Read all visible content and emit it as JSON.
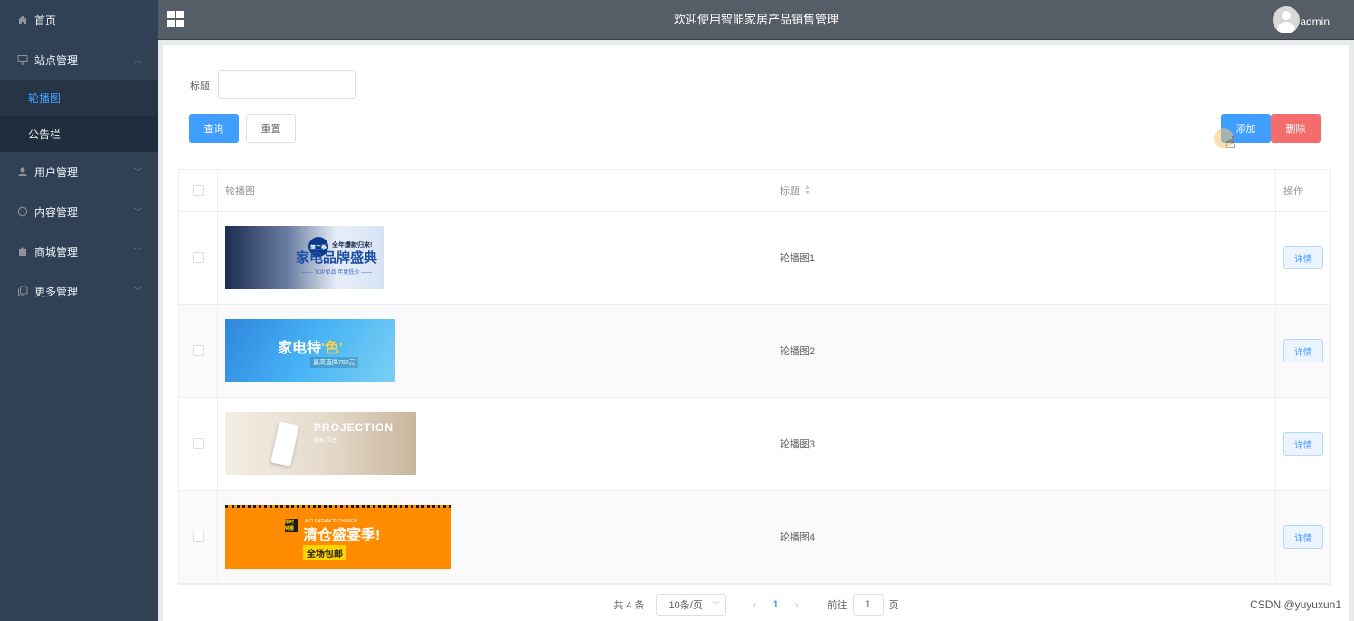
{
  "app": {
    "title": "欢迎使用智能家居产品销售管理",
    "username": "admin",
    "watermark": "CSDN @yuyuxun1"
  },
  "sidebar": {
    "items": [
      {
        "label": "首页",
        "icon": "home-icon"
      },
      {
        "label": "站点管理",
        "icon": "monitor-icon",
        "expanded": true,
        "children": [
          {
            "label": "轮播图",
            "active": true
          },
          {
            "label": "公告栏",
            "active": false
          }
        ]
      },
      {
        "label": "用户管理",
        "icon": "user-icon"
      },
      {
        "label": "内容管理",
        "icon": "chat-icon"
      },
      {
        "label": "商城管理",
        "icon": "shop-icon"
      },
      {
        "label": "更多管理",
        "icon": "copy-icon"
      }
    ]
  },
  "search": {
    "label": "标题",
    "value": "",
    "query_label": "查询",
    "reset_label": "重置"
  },
  "toolbar": {
    "add_label": "添加",
    "delete_label": "删除"
  },
  "table": {
    "headers": {
      "image": "轮播图",
      "title": "标题",
      "actions": "操作"
    },
    "rows": [
      {
        "title": "轮播图1",
        "detail_label": "详情",
        "banner": {
          "top": "全年爆款归来!",
          "main": "家电品牌盛典",
          "sub": "—— TOP单品 年度低价 ——",
          "badge": "第二季"
        }
      },
      {
        "title": "轮播图2",
        "detail_label": "详情",
        "banner": {
          "main_a": "家电特",
          "main_b": "'色'",
          "sub": "最高直降700元"
        }
      },
      {
        "title": "轮播图3",
        "detail_label": "详情",
        "banner": {
          "main": "PROJECTION",
          "sub": "投影 灵感"
        }
      },
      {
        "title": "轮播图4",
        "detail_label": "详情",
        "banner": {
          "en": "A CLEARANCE CHENGJI",
          "main": "清仓盛宴季!",
          "sub": "全场包邮",
          "tag": "限时特惠"
        }
      }
    ]
  },
  "pagination": {
    "total_text": "共 4 条",
    "page_size": "10条/页",
    "current_page": "1",
    "goto_label": "前往",
    "goto_value": "1",
    "page_unit": "页"
  },
  "colors": {
    "sidebar_bg": "#304156",
    "header_bg": "#555d66",
    "primary": "#409eff",
    "danger": "#f56c6c"
  }
}
